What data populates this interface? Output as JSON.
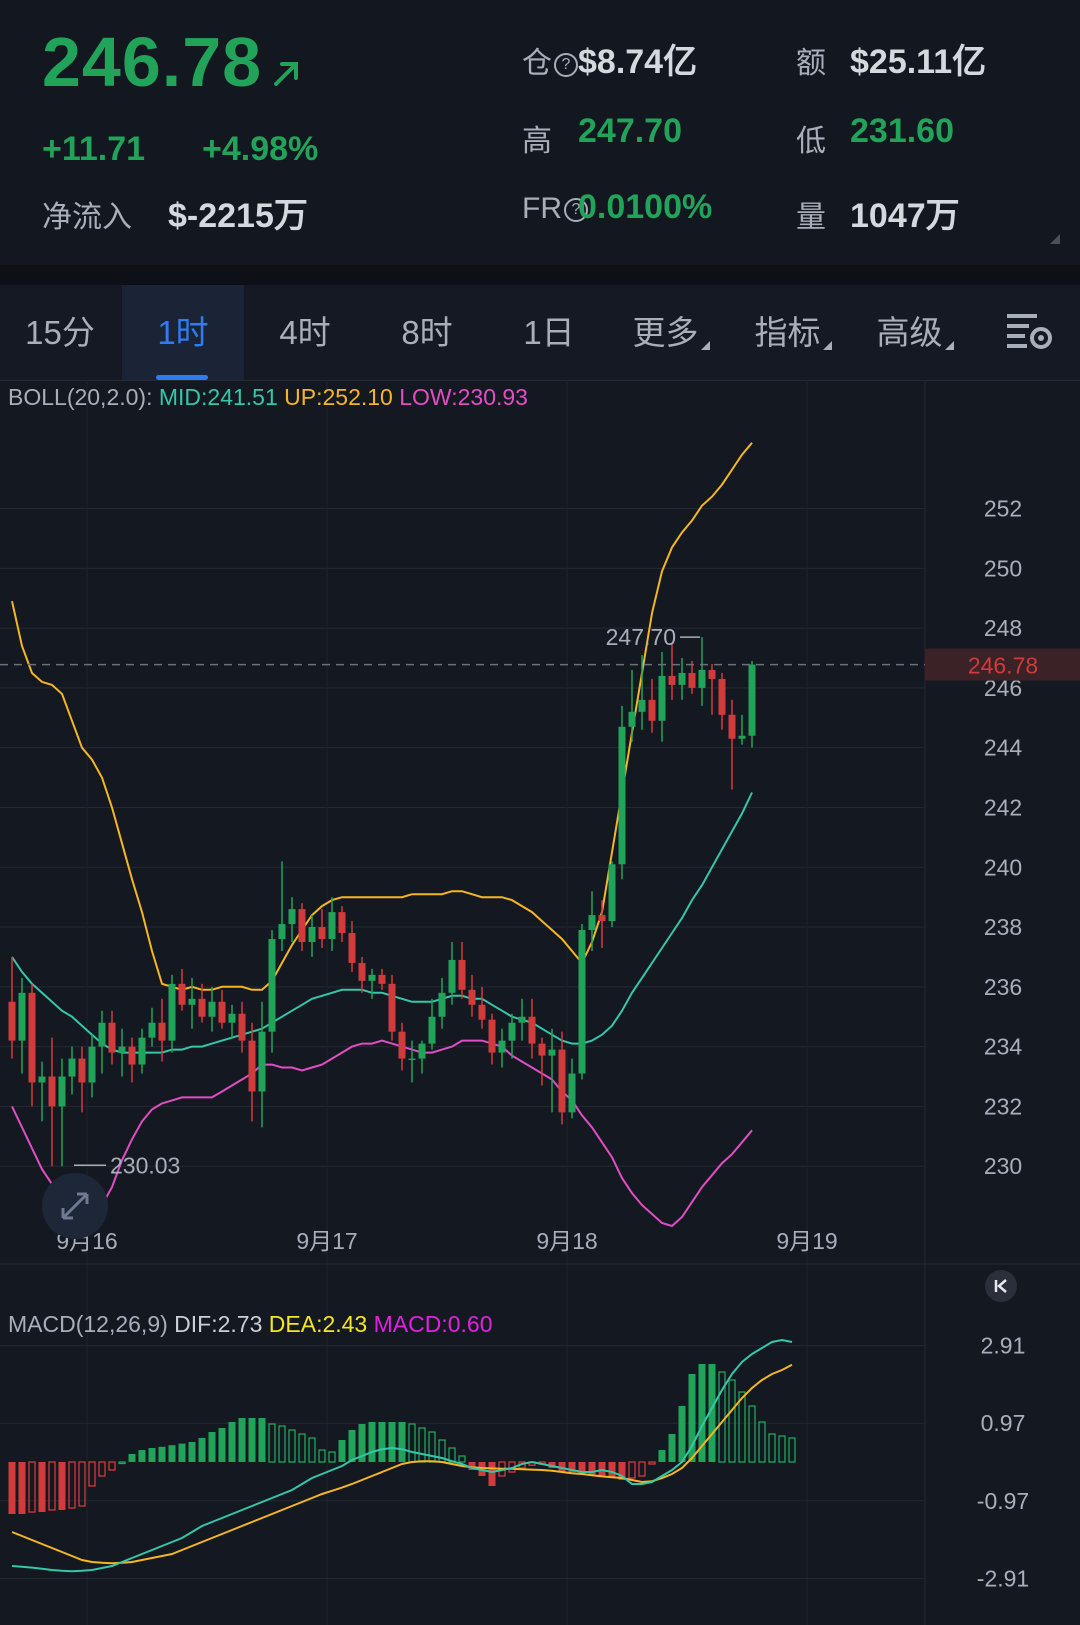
{
  "ticker": {
    "price": "246.78",
    "change": "+11.71",
    "change_pct": "+4.98%",
    "netflow_label": "净流入",
    "netflow_value": "$-2215万",
    "oi_label": "仓",
    "oi_value": "$8.74亿",
    "amount_label": "额",
    "amount_value": "$25.11亿",
    "high_label": "高",
    "high_value": "247.70",
    "low_label": "低",
    "low_value": "231.60",
    "fr_label": "FR",
    "fr_value": "0.0100%",
    "vol_label": "量",
    "vol_value": "1047万",
    "up_color": "#22a35a",
    "down_color": "#d13b3b"
  },
  "tabs": [
    {
      "label": "15分",
      "active": false
    },
    {
      "label": "1时",
      "active": true
    },
    {
      "label": "4时",
      "active": false
    },
    {
      "label": "8时",
      "active": false
    },
    {
      "label": "1日",
      "active": false
    },
    {
      "label": "更多",
      "active": false
    },
    {
      "label": "指标",
      "active": false
    },
    {
      "label": "高级",
      "active": false
    }
  ],
  "icons": {
    "settings": "chart-settings-icon",
    "expand": "expand-icon",
    "rewind": "skip-to-start-icon",
    "arrow": "arrow-up-right-icon"
  },
  "boll_legend": {
    "name": "BOLL(20,2.0):",
    "mid": "MID:241.51",
    "up": "UP:252.10",
    "low": "LOW:230.93"
  },
  "macd_legend": {
    "name": "MACD(12,26,9)",
    "dif": "DIF:2.73",
    "dea": "DEA:2.43",
    "macd": "MACD:0.60"
  },
  "chart_data": [
    {
      "type": "candlestick",
      "title": "",
      "y_ticks": [
        "252",
        "250",
        "248",
        "246",
        "244",
        "242",
        "240",
        "238",
        "236",
        "234",
        "232",
        "230"
      ],
      "ylim": [
        228.2,
        256.3
      ],
      "x_labels": [
        {
          "label": "9月16",
          "index": 7
        },
        {
          "label": "9月17",
          "index": 31
        },
        {
          "label": "9月18",
          "index": 55
        },
        {
          "label": "9月19",
          "index": 79
        }
      ],
      "current_price_label": "246.78",
      "high_annotation": "247.70",
      "low_annotation": "230.03",
      "candles": [
        [
          235.5,
          237.0,
          233.6,
          234.2
        ],
        [
          234.2,
          236.3,
          233.1,
          235.8
        ],
        [
          235.8,
          236.1,
          232.0,
          232.8
        ],
        [
          232.8,
          233.5,
          231.5,
          233.0
        ],
        [
          233.0,
          234.3,
          230.0,
          232.0
        ],
        [
          232.0,
          233.6,
          230.0,
          233.0
        ],
        [
          233.0,
          234.0,
          232.4,
          233.6
        ],
        [
          233.6,
          234.0,
          231.8,
          232.8
        ],
        [
          232.8,
          234.4,
          232.3,
          234.0
        ],
        [
          234.0,
          235.2,
          233.1,
          234.8
        ],
        [
          234.8,
          235.2,
          233.4,
          233.8
        ],
        [
          233.8,
          234.6,
          233.0,
          234.0
        ],
        [
          234.0,
          234.3,
          232.8,
          233.4
        ],
        [
          233.4,
          234.6,
          233.1,
          234.3
        ],
        [
          234.3,
          235.3,
          234.0,
          234.8
        ],
        [
          234.8,
          235.6,
          233.5,
          234.2
        ],
        [
          234.2,
          236.4,
          233.8,
          236.1
        ],
        [
          236.1,
          236.6,
          235.2,
          235.4
        ],
        [
          235.4,
          236.3,
          234.6,
          235.6
        ],
        [
          235.6,
          236.1,
          234.8,
          235.0
        ],
        [
          235.0,
          236.0,
          234.5,
          235.5
        ],
        [
          235.5,
          235.9,
          234.6,
          234.8
        ],
        [
          234.8,
          235.4,
          234.3,
          235.1
        ],
        [
          235.1,
          235.5,
          233.8,
          234.2
        ],
        [
          234.2,
          234.8,
          231.5,
          232.5
        ],
        [
          232.5,
          235.5,
          231.3,
          234.5
        ],
        [
          234.5,
          237.9,
          233.8,
          237.6
        ],
        [
          237.6,
          240.2,
          237.2,
          238.1
        ],
        [
          238.1,
          239.0,
          237.5,
          238.6
        ],
        [
          238.6,
          238.8,
          237.2,
          237.5
        ],
        [
          237.5,
          238.4,
          237.0,
          238.0
        ],
        [
          238.0,
          238.6,
          237.3,
          237.6
        ],
        [
          237.6,
          239.0,
          237.2,
          238.5
        ],
        [
          238.5,
          238.7,
          237.5,
          237.8
        ],
        [
          237.8,
          238.2,
          236.5,
          236.8
        ],
        [
          236.8,
          237.0,
          235.8,
          236.2
        ],
        [
          236.2,
          236.6,
          235.6,
          236.4
        ],
        [
          236.4,
          236.6,
          235.9,
          236.1
        ],
        [
          236.1,
          236.4,
          234.2,
          234.5
        ],
        [
          234.5,
          234.8,
          233.2,
          233.6
        ],
        [
          233.6,
          234.2,
          232.8,
          233.6
        ],
        [
          233.6,
          234.2,
          233.1,
          234.1
        ],
        [
          234.1,
          235.6,
          233.9,
          235.0
        ],
        [
          235.0,
          236.3,
          234.6,
          235.8
        ],
        [
          235.8,
          237.5,
          235.4,
          236.9
        ],
        [
          236.9,
          237.5,
          235.6,
          235.9
        ],
        [
          235.9,
          236.4,
          235.0,
          235.4
        ],
        [
          235.4,
          236.0,
          234.6,
          234.9
        ],
        [
          234.9,
          235.1,
          233.4,
          233.8
        ],
        [
          233.8,
          234.6,
          233.3,
          234.2
        ],
        [
          234.2,
          235.1,
          233.6,
          234.8
        ],
        [
          234.8,
          235.6,
          234.2,
          235.0
        ],
        [
          235.0,
          235.6,
          233.6,
          234.1
        ],
        [
          234.1,
          234.3,
          232.7,
          233.7
        ],
        [
          233.7,
          234.6,
          231.8,
          233.9
        ],
        [
          233.9,
          234.5,
          231.4,
          231.8
        ],
        [
          231.8,
          233.6,
          231.6,
          233.1
        ],
        [
          233.1,
          238.1,
          232.9,
          237.9
        ],
        [
          237.9,
          239.2,
          237.2,
          238.4
        ],
        [
          238.4,
          238.9,
          237.3,
          238.2
        ],
        [
          238.2,
          240.2,
          238.0,
          240.1
        ],
        [
          240.1,
          245.4,
          239.6,
          244.7
        ],
        [
          244.7,
          246.6,
          244.2,
          245.2
        ],
        [
          245.2,
          247.1,
          244.6,
          245.6
        ],
        [
          245.6,
          246.3,
          244.5,
          244.9
        ],
        [
          244.9,
          247.2,
          244.2,
          246.4
        ],
        [
          246.4,
          247.5,
          245.6,
          246.1
        ],
        [
          246.1,
          247.0,
          245.6,
          246.5
        ],
        [
          246.5,
          246.9,
          245.8,
          246.0
        ],
        [
          246.0,
          247.7,
          245.4,
          246.6
        ],
        [
          246.6,
          246.8,
          245.1,
          246.3
        ],
        [
          246.3,
          246.5,
          244.6,
          245.1
        ],
        [
          245.1,
          245.6,
          242.6,
          244.3
        ],
        [
          244.3,
          245.1,
          244.1,
          244.4
        ],
        [
          244.4,
          246.9,
          244.0,
          246.78
        ]
      ],
      "boll_mid": [
        237.0,
        236.5,
        236.1,
        235.8,
        235.5,
        235.2,
        235.0,
        234.7,
        234.4,
        234.1,
        233.9,
        233.8,
        233.8,
        233.8,
        233.8,
        233.8,
        233.9,
        233.9,
        234.0,
        234.0,
        234.1,
        234.2,
        234.3,
        234.4,
        234.5,
        234.6,
        234.8,
        235.0,
        235.2,
        235.4,
        235.6,
        235.7,
        235.8,
        235.9,
        235.9,
        235.9,
        235.8,
        235.8,
        235.7,
        235.6,
        235.5,
        235.5,
        235.5,
        235.6,
        235.7,
        235.7,
        235.6,
        235.6,
        235.4,
        235.2,
        235.0,
        234.9,
        234.8,
        234.6,
        234.4,
        234.2,
        234.1,
        234.1,
        234.2,
        234.4,
        234.7,
        235.2,
        235.8,
        236.3,
        236.8,
        237.3,
        237.8,
        238.3,
        238.9,
        239.4,
        240.0,
        240.6,
        241.2,
        241.8,
        242.5
      ],
      "boll_up": [
        248.9,
        247.4,
        246.5,
        246.2,
        246.1,
        245.8,
        244.9,
        244.0,
        243.6,
        243.0,
        242.0,
        240.8,
        239.6,
        238.5,
        237.2,
        236.1,
        236.0,
        235.9,
        236.0,
        235.9,
        235.9,
        236.0,
        236.0,
        236.0,
        235.9,
        235.9,
        236.2,
        236.8,
        237.4,
        237.9,
        238.4,
        238.7,
        238.9,
        239.0,
        239.0,
        239.0,
        239.0,
        239.0,
        239.0,
        239.0,
        239.1,
        239.1,
        239.1,
        239.1,
        239.2,
        239.2,
        239.1,
        239.0,
        239.0,
        239.0,
        238.9,
        238.7,
        238.5,
        238.2,
        237.9,
        237.6,
        237.2,
        236.8,
        237.5,
        238.5,
        240.5,
        242.5,
        244.5,
        246.5,
        248.5,
        249.9,
        250.7,
        251.2,
        251.6,
        252.1,
        252.4,
        252.8,
        253.3,
        253.8,
        254.2
      ],
      "boll_low": [
        232.0,
        231.3,
        230.6,
        229.9,
        229.4,
        229.0,
        228.8,
        228.7,
        228.6,
        228.7,
        229.3,
        230.2,
        230.9,
        231.5,
        231.9,
        232.1,
        232.2,
        232.3,
        232.3,
        232.3,
        232.3,
        232.5,
        232.7,
        232.9,
        233.1,
        233.4,
        233.4,
        233.3,
        233.3,
        233.2,
        233.3,
        233.4,
        233.6,
        233.8,
        234.0,
        234.1,
        234.1,
        234.2,
        234.1,
        234.0,
        233.9,
        233.8,
        233.8,
        233.9,
        234.0,
        234.2,
        234.2,
        234.2,
        234.1,
        234.0,
        233.7,
        233.5,
        233.3,
        233.1,
        232.9,
        232.5,
        232.2,
        231.7,
        231.3,
        230.8,
        230.3,
        229.6,
        229.1,
        228.7,
        228.4,
        228.1,
        228.0,
        228.3,
        228.8,
        229.3,
        229.7,
        230.1,
        230.4,
        230.8,
        231.2
      ]
    },
    {
      "type": "bar+line",
      "title": "",
      "y_ticks": [
        "2.91",
        "0.97",
        "-0.97",
        "-2.91"
      ],
      "ylim": [
        -2.91,
        2.91
      ],
      "macd_hist": [
        -1.3,
        -1.3,
        -1.25,
        -1.25,
        -1.2,
        -1.2,
        -1.15,
        -1.1,
        -0.6,
        -0.35,
        -0.2,
        0.0,
        0.2,
        0.3,
        0.35,
        0.38,
        0.42,
        0.46,
        0.5,
        0.6,
        0.75,
        0.85,
        1.0,
        1.1,
        1.1,
        1.1,
        0.95,
        0.9,
        0.8,
        0.7,
        0.6,
        0.3,
        0.25,
        0.55,
        0.8,
        0.95,
        1.0,
        1.0,
        1.0,
        1.0,
        0.95,
        0.85,
        0.75,
        0.55,
        0.35,
        0.15,
        -0.2,
        -0.35,
        -0.6,
        -0.35,
        -0.25,
        -0.15,
        -0.08,
        -0.05,
        -0.15,
        -0.25,
        -0.25,
        -0.3,
        -0.35,
        -0.35,
        -0.4,
        -0.45,
        -0.4,
        -0.35,
        -0.05,
        0.3,
        0.7,
        1.4,
        2.2,
        2.45,
        2.45,
        2.25,
        2.05,
        1.75,
        1.4,
        1.0,
        0.7,
        0.65,
        0.6
      ],
      "dif": [
        -2.6,
        -2.62,
        -2.64,
        -2.67,
        -2.7,
        -2.72,
        -2.73,
        -2.72,
        -2.7,
        -2.65,
        -2.6,
        -2.5,
        -2.4,
        -2.3,
        -2.2,
        -2.1,
        -2.0,
        -1.9,
        -1.75,
        -1.6,
        -1.5,
        -1.4,
        -1.3,
        -1.2,
        -1.1,
        -1.0,
        -0.9,
        -0.8,
        -0.7,
        -0.55,
        -0.4,
        -0.3,
        -0.2,
        -0.1,
        0.05,
        0.15,
        0.25,
        0.32,
        0.35,
        0.32,
        0.25,
        0.2,
        0.15,
        0.1,
        0.02,
        -0.05,
        -0.15,
        -0.2,
        -0.25,
        -0.2,
        -0.15,
        -0.05,
        0.0,
        -0.05,
        -0.1,
        -0.15,
        -0.2,
        -0.25,
        -0.25,
        -0.2,
        -0.25,
        -0.35,
        -0.55,
        -0.55,
        -0.5,
        -0.35,
        -0.2,
        0.0,
        0.4,
        0.9,
        1.35,
        1.8,
        2.2,
        2.5,
        2.7,
        2.85,
        3.0,
        3.05,
        3.0
      ],
      "dea": [
        -1.75,
        -1.85,
        -1.95,
        -2.05,
        -2.15,
        -2.25,
        -2.35,
        -2.45,
        -2.5,
        -2.52,
        -2.53,
        -2.52,
        -2.5,
        -2.45,
        -2.4,
        -2.35,
        -2.3,
        -2.2,
        -2.1,
        -2.0,
        -1.9,
        -1.8,
        -1.7,
        -1.6,
        -1.5,
        -1.4,
        -1.3,
        -1.2,
        -1.1,
        -1.0,
        -0.9,
        -0.8,
        -0.72,
        -0.64,
        -0.55,
        -0.45,
        -0.35,
        -0.25,
        -0.15,
        -0.05,
        0.0,
        0.02,
        0.02,
        0.0,
        -0.05,
        -0.1,
        -0.13,
        -0.15,
        -0.16,
        -0.17,
        -0.17,
        -0.18,
        -0.19,
        -0.2,
        -0.22,
        -0.25,
        -0.28,
        -0.3,
        -0.33,
        -0.36,
        -0.38,
        -0.4,
        -0.45,
        -0.5,
        -0.48,
        -0.4,
        -0.3,
        -0.15,
        0.1,
        0.4,
        0.7,
        1.0,
        1.3,
        1.6,
        1.85,
        2.05,
        2.2,
        2.3,
        2.43
      ]
    }
  ]
}
